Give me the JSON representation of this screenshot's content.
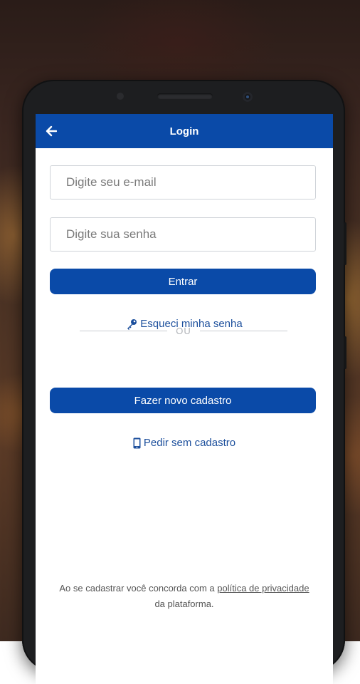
{
  "header": {
    "title": "Login"
  },
  "form": {
    "email_placeholder": "Digite seu e-mail",
    "password_placeholder": "Digite sua senha",
    "login_button": "Entrar"
  },
  "links": {
    "forgot_password": "Esqueci minha senha",
    "divider_text": "OU",
    "register_button": "Fazer novo cadastro",
    "order_without_account": "Pedir sem cadastro"
  },
  "terms": {
    "prefix": "Ao se cadastrar você concorda com a ",
    "link": "política de privacidade",
    "suffix": " da plataforma."
  },
  "colors": {
    "primary": "#0a4aa8",
    "link": "#1c4f9c"
  },
  "icons": {
    "back": "arrow-left-icon",
    "forgot": "key-icon",
    "order": "phone-icon"
  }
}
